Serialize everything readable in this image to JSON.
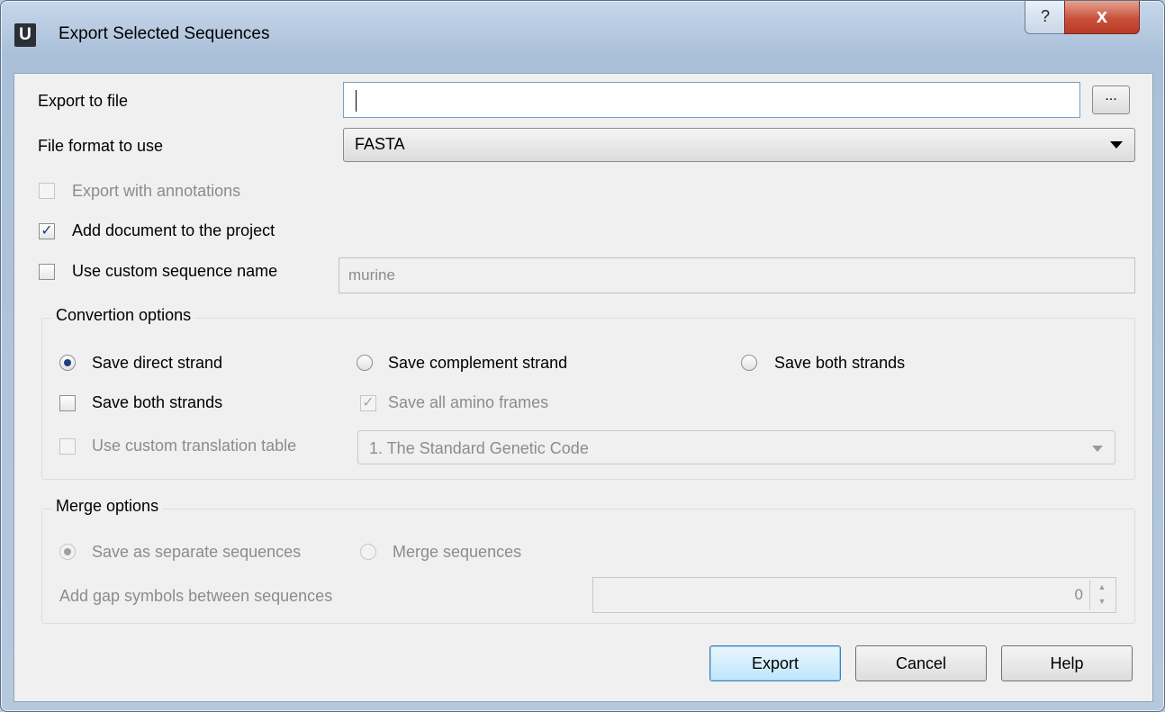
{
  "window": {
    "title": "Export Selected Sequences",
    "app_icon_letter": "U",
    "help_glyph": "?",
    "close_glyph": "x"
  },
  "export_to_file": {
    "label": "Export to file",
    "value": "",
    "browse_label": "..."
  },
  "file_format": {
    "label": "File format to use",
    "selected": "FASTA"
  },
  "export_with_annotations": {
    "label": "Export with annotations",
    "checked": false,
    "enabled": false
  },
  "add_document": {
    "label": "Add document to the project",
    "checked": true
  },
  "custom_name": {
    "label": "Use custom sequence name",
    "checked": false,
    "value": "murine"
  },
  "conversion": {
    "title": "Convertion options",
    "radio_direct": "Save direct strand",
    "radio_complement": "Save complement strand",
    "radio_both": "Save both strands",
    "selected": "Save direct strand",
    "check_both_strands": "Save both strands",
    "check_amino_frames": "Save all amino frames",
    "check_custom_table": "Use custom translation table",
    "translation_table": "1. The Standard Genetic Code"
  },
  "merge": {
    "title": "Merge options",
    "radio_separate": "Save as separate sequences",
    "radio_merge": "Merge sequences",
    "gap_label": "Add gap symbols between sequences",
    "gap_value": "0"
  },
  "buttons": {
    "export": "Export",
    "cancel": "Cancel",
    "help": "Help"
  },
  "colors": {
    "title_bar": "#c7d7ea",
    "close_button": "#c9503b",
    "dialog_bg": "#f0f0f0",
    "default_button": "#bee6fd"
  }
}
